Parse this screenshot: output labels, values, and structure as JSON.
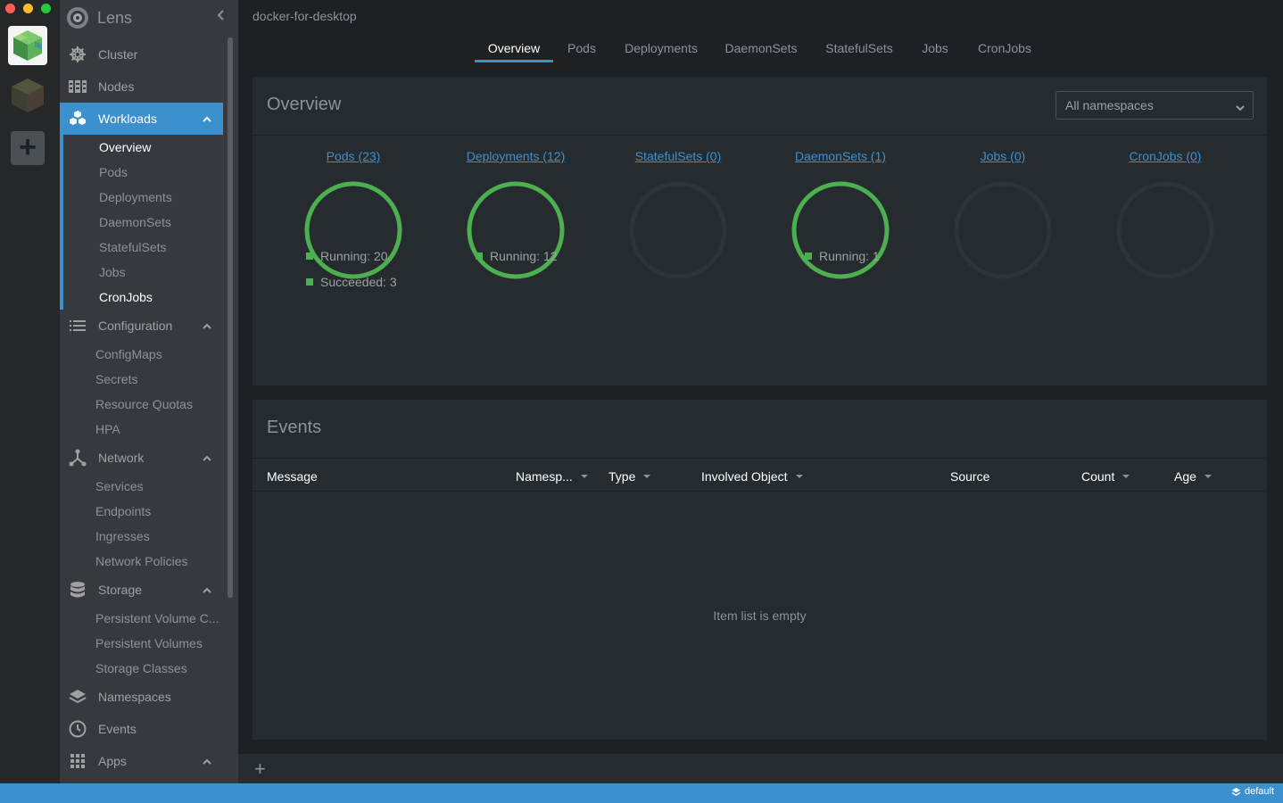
{
  "app": {
    "title": "Lens",
    "cluster_name": "docker-for-desktop"
  },
  "colors": {
    "accent": "#3d90ce",
    "success": "#4caf50",
    "ring_empty": "#2f3337"
  },
  "sidebar": {
    "items": [
      {
        "label": "Cluster",
        "icon": "cluster-helm-icon"
      },
      {
        "label": "Nodes",
        "icon": "nodes-icon"
      },
      {
        "label": "Workloads",
        "icon": "workloads-icon",
        "active": true,
        "expanded": true
      },
      {
        "label": "Configuration",
        "icon": "configuration-list-icon",
        "expanded": true
      },
      {
        "label": "Network",
        "icon": "network-icon",
        "expanded": true
      },
      {
        "label": "Storage",
        "icon": "storage-icon",
        "expanded": true
      },
      {
        "label": "Namespaces",
        "icon": "namespaces-layers-icon"
      },
      {
        "label": "Events",
        "icon": "events-clock-icon"
      },
      {
        "label": "Apps",
        "icon": "apps-grid-icon",
        "expanded": true
      }
    ],
    "workloads_sub": [
      "Overview",
      "Pods",
      "Deployments",
      "DaemonSets",
      "StatefulSets",
      "Jobs",
      "CronJobs"
    ],
    "configuration_sub": [
      "ConfigMaps",
      "Secrets",
      "Resource Quotas",
      "HPA"
    ],
    "network_sub": [
      "Services",
      "Endpoints",
      "Ingresses",
      "Network Policies"
    ],
    "storage_sub": [
      "Persistent Volume C...",
      "Persistent Volumes",
      "Storage Classes"
    ]
  },
  "tabs": [
    "Overview",
    "Pods",
    "Deployments",
    "DaemonSets",
    "StatefulSets",
    "Jobs",
    "CronJobs"
  ],
  "overview": {
    "title": "Overview",
    "namespace_select": "All namespaces",
    "workloads": [
      {
        "label": "Pods (23)",
        "filled": true,
        "legend": [
          "Running: 20",
          "Succeeded: 3"
        ]
      },
      {
        "label": "Deployments (12)",
        "filled": true,
        "legend": [
          "Running: 12"
        ]
      },
      {
        "label": "StatefulSets (0)",
        "filled": false,
        "legend": []
      },
      {
        "label": "DaemonSets (1)",
        "filled": true,
        "legend": [
          "Running: 1"
        ]
      },
      {
        "label": "Jobs (0)",
        "filled": false,
        "legend": []
      },
      {
        "label": "CronJobs (0)",
        "filled": false,
        "legend": []
      }
    ]
  },
  "events": {
    "title": "Events",
    "columns": [
      "Message",
      "Namesp...",
      "Type",
      "Involved Object",
      "Source",
      "Count",
      "Age"
    ],
    "empty": "Item list is empty"
  },
  "status": {
    "context": "default"
  }
}
